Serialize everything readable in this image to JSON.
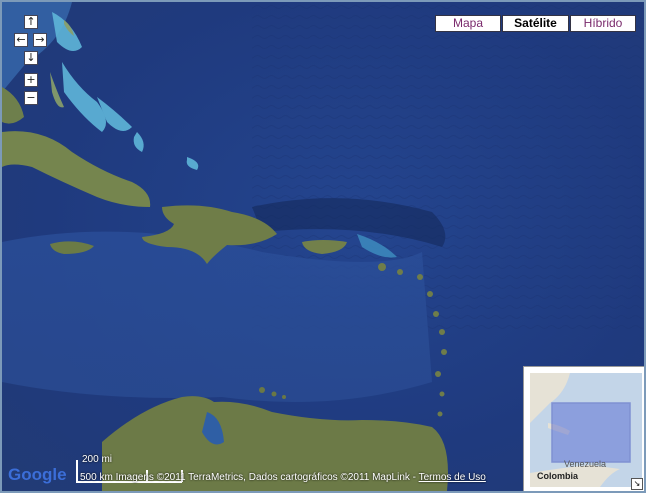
{
  "map_types": [
    {
      "label": "Mapa",
      "active": false
    },
    {
      "label": "Satélite",
      "active": true
    },
    {
      "label": "Híbrido",
      "active": false
    }
  ],
  "controls": {
    "pan_up": "↑",
    "pan_left": "←",
    "pan_right": "→",
    "pan_down": "↓",
    "zoom_in": "+",
    "zoom_out": "−"
  },
  "scale": {
    "imperial": "200 mi",
    "metric": "500 km"
  },
  "attribution": {
    "text": "Imagens ©2011 TerraMetrics, Dados cartográficos ©2011 MapLink - ",
    "terms_link": "Termos de Uso"
  },
  "logo": "Google",
  "overview": {
    "label_country": "Colombia",
    "label_venezuela": "Venezuela"
  },
  "colors": {
    "ocean_deep": "#1f3f86",
    "ocean_shallow": "#3d8fc8",
    "land": "#6c7c48",
    "link": "#7a2a6c"
  }
}
